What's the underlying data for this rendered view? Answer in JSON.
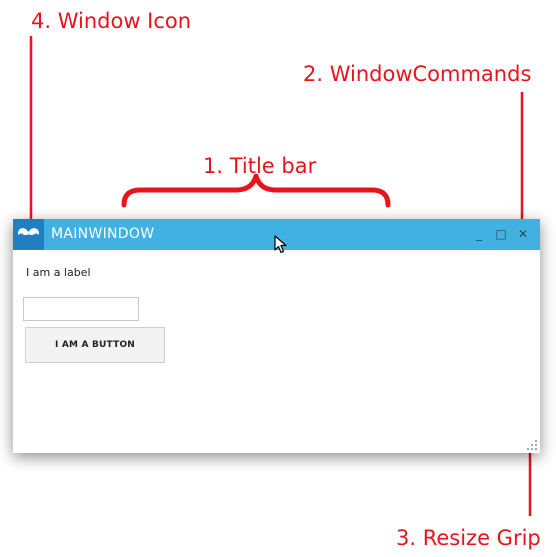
{
  "annotations": {
    "window_icon": "4. Window Icon",
    "window_commands": "2. WindowCommands",
    "title_bar": "1. Title bar",
    "resize_grip": "3. Resize Grip"
  },
  "window": {
    "title": "MAINWINDOW",
    "commands": {
      "minimize": "_",
      "maximize": "□",
      "close": "✕"
    },
    "content": {
      "label": "I am a label",
      "input_value": "",
      "button_label": "I AM A BUTTON"
    }
  },
  "colors": {
    "titlebar": "#41b1e1",
    "icon_bg": "#1f7fc0",
    "annotation": "#e8141b"
  },
  "icons": [
    "mustache-icon",
    "cursor-icon",
    "resize-grip-icon"
  ]
}
